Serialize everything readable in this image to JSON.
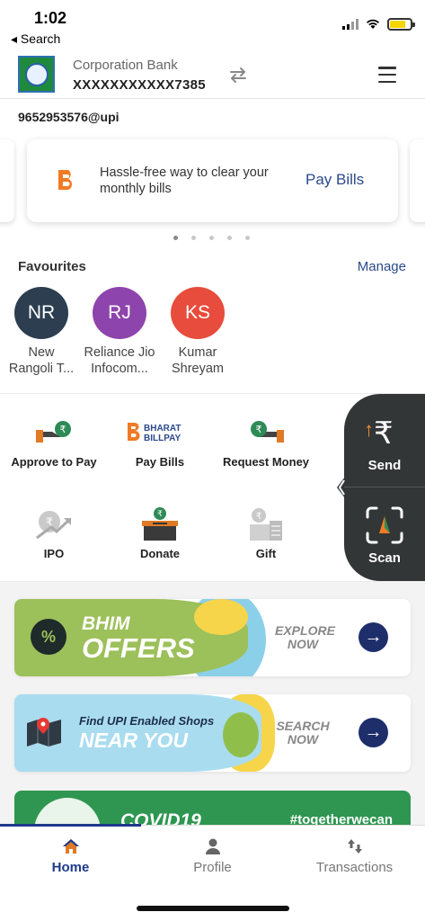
{
  "status_bar": {
    "time": "1:02",
    "back_label": "◂ Search"
  },
  "header": {
    "bank_name": "Corporation Bank",
    "account": "XXXXXXXXXXX7385"
  },
  "upi_id": "9652953576@upi",
  "banner": {
    "text": "Hassle-free way to clear your monthly bills",
    "cta": "Pay Bills",
    "page_count": 5,
    "active_page": 1
  },
  "favourites": {
    "title": "Favourites",
    "manage": "Manage",
    "items": [
      {
        "initials": "NR",
        "name": "New Rangoli T...",
        "color": "#2c3e50"
      },
      {
        "initials": "RJ",
        "name": "Reliance Jio Infocom...",
        "color": "#8e44ad"
      },
      {
        "initials": "KS",
        "name": "Kumar Shreyam",
        "color": "#e74c3c"
      }
    ]
  },
  "fav_lines": [
    [
      "New",
      "Rangoli T..."
    ],
    [
      "Reliance Jio",
      "Infocom..."
    ],
    [
      "Kumar",
      "Shreyam"
    ]
  ],
  "actions": {
    "items": [
      {
        "label": "Approve to Pay",
        "icon": "approve-pay-icon"
      },
      {
        "label": "Pay Bills",
        "icon": "bharat-billpay-icon"
      },
      {
        "label": "Request Money",
        "icon": "request-money-icon"
      },
      {
        "label": "IPO",
        "icon": "ipo-icon"
      },
      {
        "label": "Donate",
        "icon": "donate-icon"
      },
      {
        "label": "Gift",
        "icon": "gift-icon"
      }
    ],
    "bharat_billpay_logo": [
      "BHARAT",
      "BILLPAY"
    ],
    "send_label": "Send",
    "scan_label": "Scan"
  },
  "promos": {
    "offers": {
      "line1": "BHIM",
      "line2": "OFFERS",
      "cta1": "EXPLORE",
      "cta2": "NOW"
    },
    "shops": {
      "line1": "Find UPI Enabled Shops",
      "line2": "NEAR YOU",
      "cta1": "SEARCH",
      "cta2": "NOW"
    },
    "covid": {
      "title": "COVID19",
      "hashtag": "#togetherwecan"
    }
  },
  "bottom_nav": {
    "home": "Home",
    "profile": "Profile",
    "transactions": "Transactions",
    "active": "home"
  },
  "colors": {
    "brand_blue": "#2b4a8a",
    "nav_active": "#1e3a8a",
    "side_panel": "#333637",
    "offers_green": "#9cc05a",
    "shops_blue": "#a9dcef",
    "covid_green": "#2e9650"
  }
}
